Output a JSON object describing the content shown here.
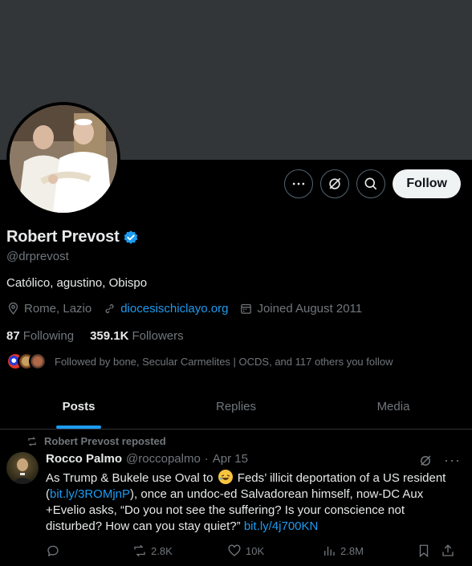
{
  "profile": {
    "name": "Robert Prevost",
    "handle": "@drprevost",
    "bio": "Católico, agustino, Obispo",
    "location": "Rome, Lazio",
    "website": "diocesischiclayo.org",
    "joined": "Joined August 2011",
    "following_count": "87",
    "following_label": "Following",
    "followers_count": "359.1K",
    "followers_label": "Followers",
    "followed_by": "Followed by bone, Secular Carmelites | OCDS, and 117 others you follow"
  },
  "actions": {
    "follow_label": "Follow"
  },
  "tabs": [
    {
      "label": "Posts",
      "active": true
    },
    {
      "label": "Replies",
      "active": false
    },
    {
      "label": "Media",
      "active": false
    }
  ],
  "tweet": {
    "repost_note": "Robert Prevost reposted",
    "author": "Rocco Palmo",
    "handle": "@roccopalmo",
    "separator": "·",
    "date": "Apr 15",
    "text_1": "As Trump & Bukele use Oval to",
    "text_2": "Feds’ illicit deportation of a US resident (",
    "link_1": "bit.ly/3ROMjnP",
    "text_3": "), once an undoc-ed Salvadorean himself, now-DC Aux +Evelio asks, “Do you not see the suffering? Is your conscience not disturbed? How can you stay quiet?”",
    "link_2": "bit.ly/4j700KN",
    "reposts": "2.8K",
    "likes": "10K",
    "views": "2.8M"
  },
  "colors": {
    "accent": "#1d9bf0",
    "banner": "#333639",
    "muted": "#71767b"
  },
  "icons": [
    "more-icon",
    "grok-icon",
    "search-icon",
    "verified-badge-icon",
    "location-icon",
    "link-icon",
    "calendar-icon",
    "repost-icon",
    "reply-icon",
    "like-icon",
    "views-icon",
    "bookmark-icon",
    "share-icon"
  ]
}
